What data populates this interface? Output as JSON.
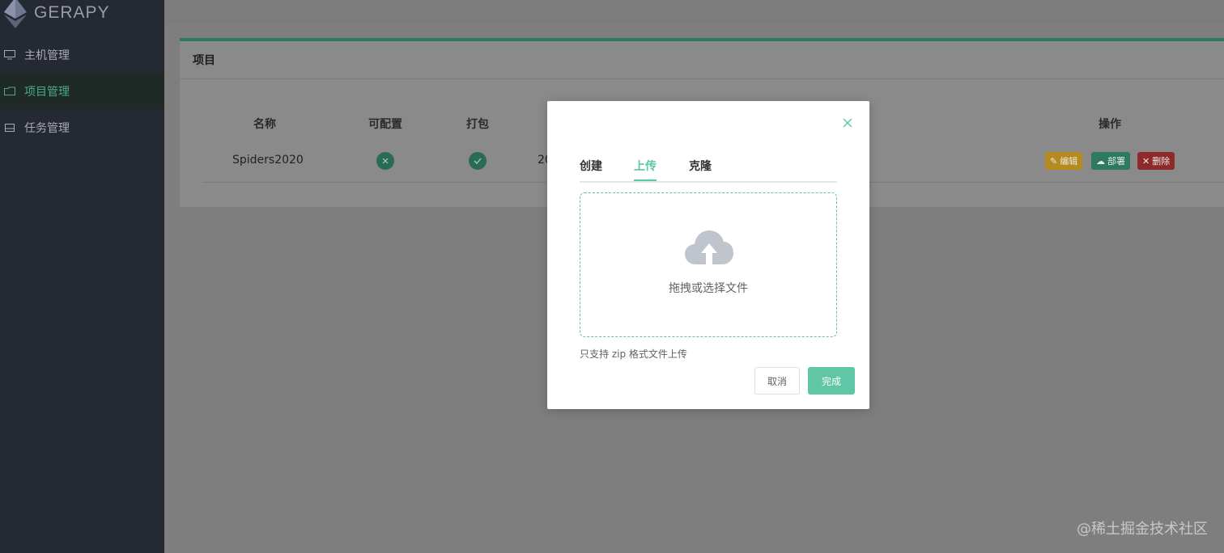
{
  "app": {
    "logo_text": "GERAPY"
  },
  "sidebar": {
    "items": [
      {
        "label": "主机管理",
        "icon": "monitor-icon",
        "active": false
      },
      {
        "label": "项目管理",
        "icon": "folder-icon",
        "active": true
      },
      {
        "label": "任务管理",
        "icon": "inbox-icon",
        "active": false
      }
    ]
  },
  "card": {
    "title": "项目",
    "columns": [
      "名称",
      "可配置",
      "打包",
      "操作"
    ],
    "rows": [
      {
        "name": "Spiders2020",
        "configurable": "no",
        "packaged": "yes",
        "partial_text": "20",
        "actions": [
          "编辑",
          "部署",
          "删除"
        ]
      }
    ]
  },
  "modal": {
    "tabs": [
      "创建",
      "上传",
      "克隆"
    ],
    "active_tab": "上传",
    "dropzone_text": "拖拽或选择文件",
    "tip": "只支持 zip 格式文件上传",
    "cancel_label": "取消",
    "done_label": "完成"
  },
  "watermark": "@稀土掘金技术社区",
  "colors": {
    "accent": "#5ac8a1",
    "sidebar_bg": "#252934",
    "edit": "#b58a1e",
    "deploy": "#2d7a5f",
    "delete": "#8f2a2a"
  }
}
